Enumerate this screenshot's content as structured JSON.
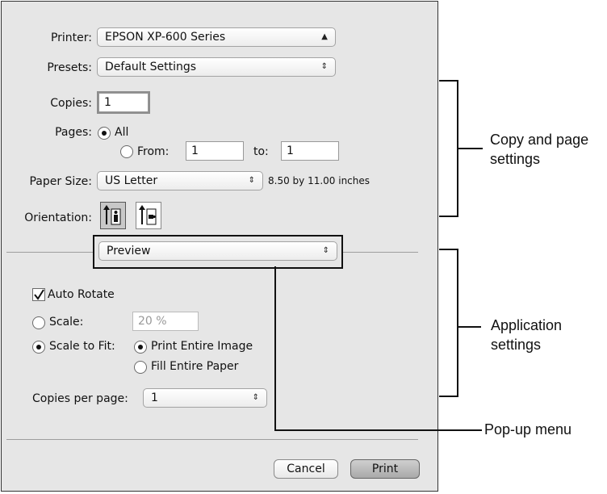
{
  "printer": {
    "label": "Printer:",
    "value": "EPSON XP-600 Series"
  },
  "presets": {
    "label": "Presets:",
    "value": "Default Settings"
  },
  "copies": {
    "label": "Copies:",
    "value": "1"
  },
  "pages": {
    "label": "Pages:",
    "all_label": "All",
    "from_label": "From:",
    "from_value": "1",
    "to_label": "to:",
    "to_value": "1",
    "selected": "All"
  },
  "paper_size": {
    "label": "Paper Size:",
    "value": "US Letter",
    "dimensions": "8.50 by 11.00 inches"
  },
  "orientation": {
    "label": "Orientation:",
    "options": [
      "portrait",
      "landscape"
    ],
    "selected": "portrait"
  },
  "popup_menu": {
    "value": "Preview"
  },
  "preview": {
    "auto_rotate_label": "Auto Rotate",
    "auto_rotate_checked": true,
    "scale_label": "Scale:",
    "scale_value": "20 %",
    "scale_to_fit_label": "Scale to Fit:",
    "print_entire_image_label": "Print Entire Image",
    "fill_entire_paper_label": "Fill Entire Paper",
    "selected_scaling": "Scale to Fit",
    "selected_fit": "Print Entire Image",
    "copies_per_page_label": "Copies per page:",
    "copies_per_page_value": "1"
  },
  "buttons": {
    "cancel": "Cancel",
    "print": "Print"
  },
  "callouts": {
    "copy_page_settings": [
      "Copy and page",
      "settings"
    ],
    "application_settings": [
      "Application",
      "settings"
    ],
    "popup_menu": "Pop-up menu"
  }
}
